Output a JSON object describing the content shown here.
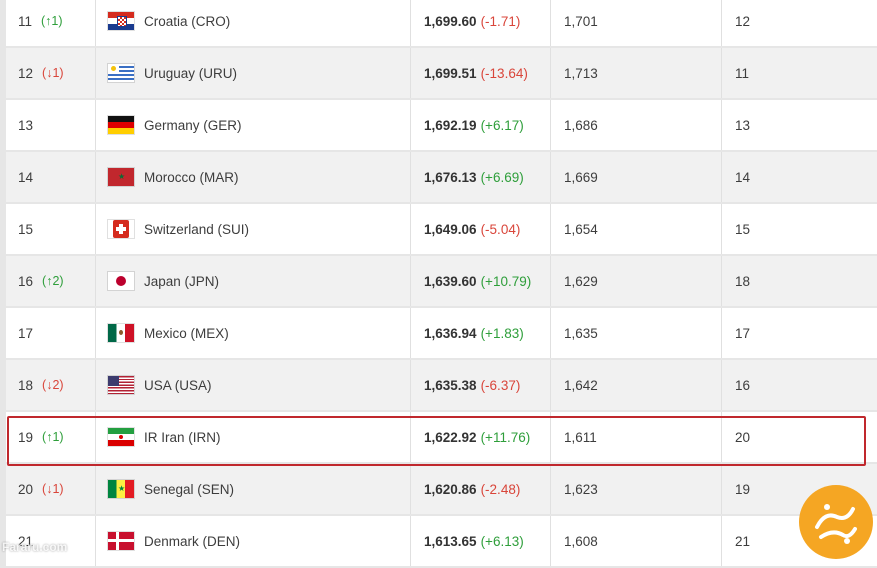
{
  "rows": [
    {
      "rank": "11",
      "change": "(↑1)",
      "dir": "up",
      "team": "Croatia (CRO)",
      "flag": "croatia",
      "points": "1,699.60",
      "delta": "(-1.71)",
      "delta_dir": "down",
      "prev_points": "1,701",
      "prev_rank": "12"
    },
    {
      "rank": "12",
      "change": "(↓1)",
      "dir": "down",
      "team": "Uruguay (URU)",
      "flag": "uruguay",
      "points": "1,699.51",
      "delta": "(-13.64)",
      "delta_dir": "down",
      "prev_points": "1,713",
      "prev_rank": "11"
    },
    {
      "rank": "13",
      "change": "",
      "dir": "",
      "team": "Germany (GER)",
      "flag": "germany",
      "points": "1,692.19",
      "delta": "(+6.17)",
      "delta_dir": "up",
      "prev_points": "1,686",
      "prev_rank": "13"
    },
    {
      "rank": "14",
      "change": "",
      "dir": "",
      "team": "Morocco (MAR)",
      "flag": "morocco",
      "points": "1,676.13",
      "delta": "(+6.69)",
      "delta_dir": "up",
      "prev_points": "1,669",
      "prev_rank": "14"
    },
    {
      "rank": "15",
      "change": "",
      "dir": "",
      "team": "Switzerland (SUI)",
      "flag": "switzerland",
      "points": "1,649.06",
      "delta": "(-5.04)",
      "delta_dir": "down",
      "prev_points": "1,654",
      "prev_rank": "15"
    },
    {
      "rank": "16",
      "change": "(↑2)",
      "dir": "up",
      "team": "Japan (JPN)",
      "flag": "japan",
      "points": "1,639.60",
      "delta": "(+10.79)",
      "delta_dir": "up",
      "prev_points": "1,629",
      "prev_rank": "18"
    },
    {
      "rank": "17",
      "change": "",
      "dir": "",
      "team": "Mexico (MEX)",
      "flag": "mexico",
      "points": "1,636.94",
      "delta": "(+1.83)",
      "delta_dir": "up",
      "prev_points": "1,635",
      "prev_rank": "17"
    },
    {
      "rank": "18",
      "change": "(↓2)",
      "dir": "down",
      "team": "USA (USA)",
      "flag": "usa",
      "points": "1,635.38",
      "delta": "(-6.37)",
      "delta_dir": "down",
      "prev_points": "1,642",
      "prev_rank": "16"
    },
    {
      "rank": "19",
      "change": "(↑1)",
      "dir": "up",
      "team": "IR Iran (IRN)",
      "flag": "iran",
      "points": "1,622.92",
      "delta": "(+11.76)",
      "delta_dir": "up",
      "prev_points": "1,611",
      "prev_rank": "20"
    },
    {
      "rank": "20",
      "change": "(↓1)",
      "dir": "down",
      "team": "Senegal (SEN)",
      "flag": "senegal",
      "points": "1,620.86",
      "delta": "(-2.48)",
      "delta_dir": "down",
      "prev_points": "1,623",
      "prev_rank": "19"
    },
    {
      "rank": "21",
      "change": "",
      "dir": "",
      "team": "Denmark (DEN)",
      "flag": "denmark",
      "points": "1,613.65",
      "delta": "(+6.13)",
      "delta_dir": "up",
      "prev_points": "1,608",
      "prev_rank": "21"
    }
  ],
  "highlighted_team": "IR Iran (IRN)",
  "watermark": "Fararu.com",
  "logo_icon": "fararu-logo-icon",
  "colors": {
    "up": "#2e9e3a",
    "down": "#d9453a",
    "highlight": "#c0282d"
  }
}
